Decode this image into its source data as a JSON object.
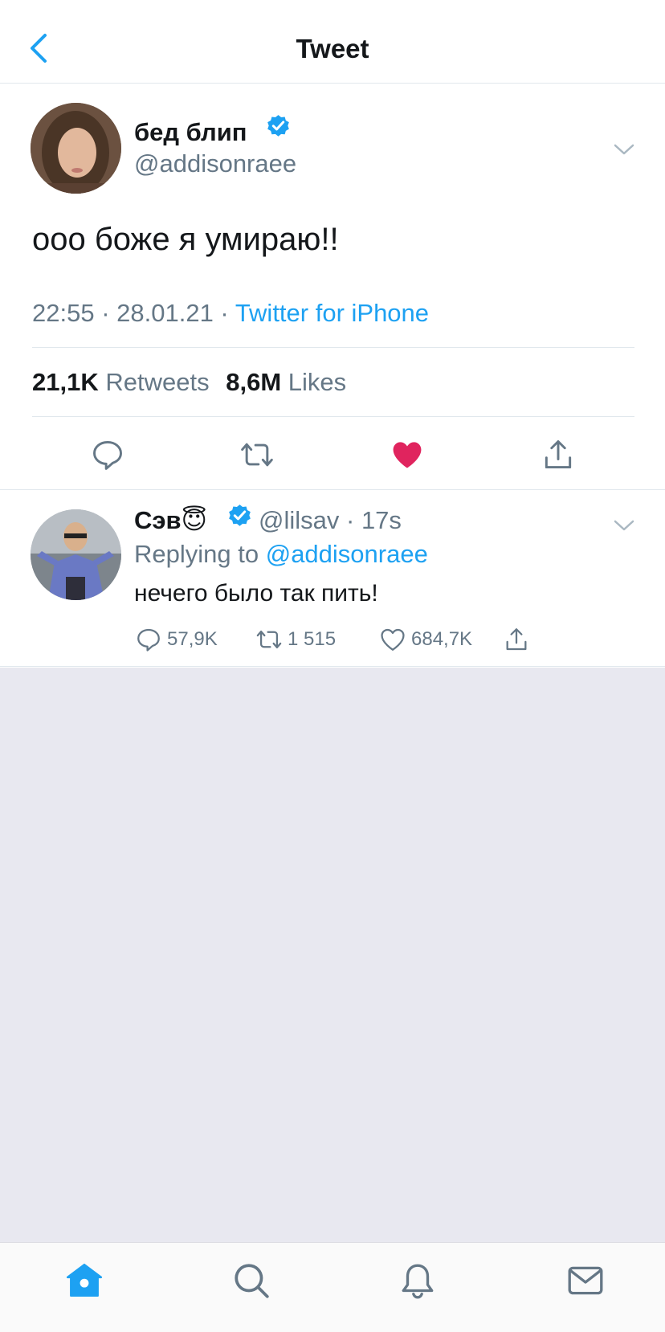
{
  "header": {
    "title": "Tweet",
    "back_icon": "chevron-left-icon"
  },
  "tweet": {
    "display_name": "бед блип",
    "handle": "@addisonraee",
    "text": "ооо боже я умираю!!",
    "time": "22:55",
    "date": "28.01.21",
    "source": "Twitter for iPhone",
    "retweets_count": "21,1K",
    "retweets_label": "Retweets",
    "likes_count": "8,6M",
    "likes_label": "Likes",
    "liked": true
  },
  "reply": {
    "display_name": "Сэв😇",
    "handle": "@lilsav",
    "age": "17s",
    "replying_prefix": "Replying to",
    "replying_to": "@addisonraee",
    "text": "нечего было так пить!",
    "reply_count": "57,9K",
    "retweet_count": "1 515",
    "like_count": "684,7K"
  },
  "tabs": [
    "home-icon",
    "search-icon",
    "notifications-icon",
    "messages-icon"
  ],
  "colors": {
    "accent": "#1da1f2",
    "like": "#e0245e",
    "text": "#14171a",
    "muted": "#657786",
    "empty_bg": "#e8e8f0"
  }
}
